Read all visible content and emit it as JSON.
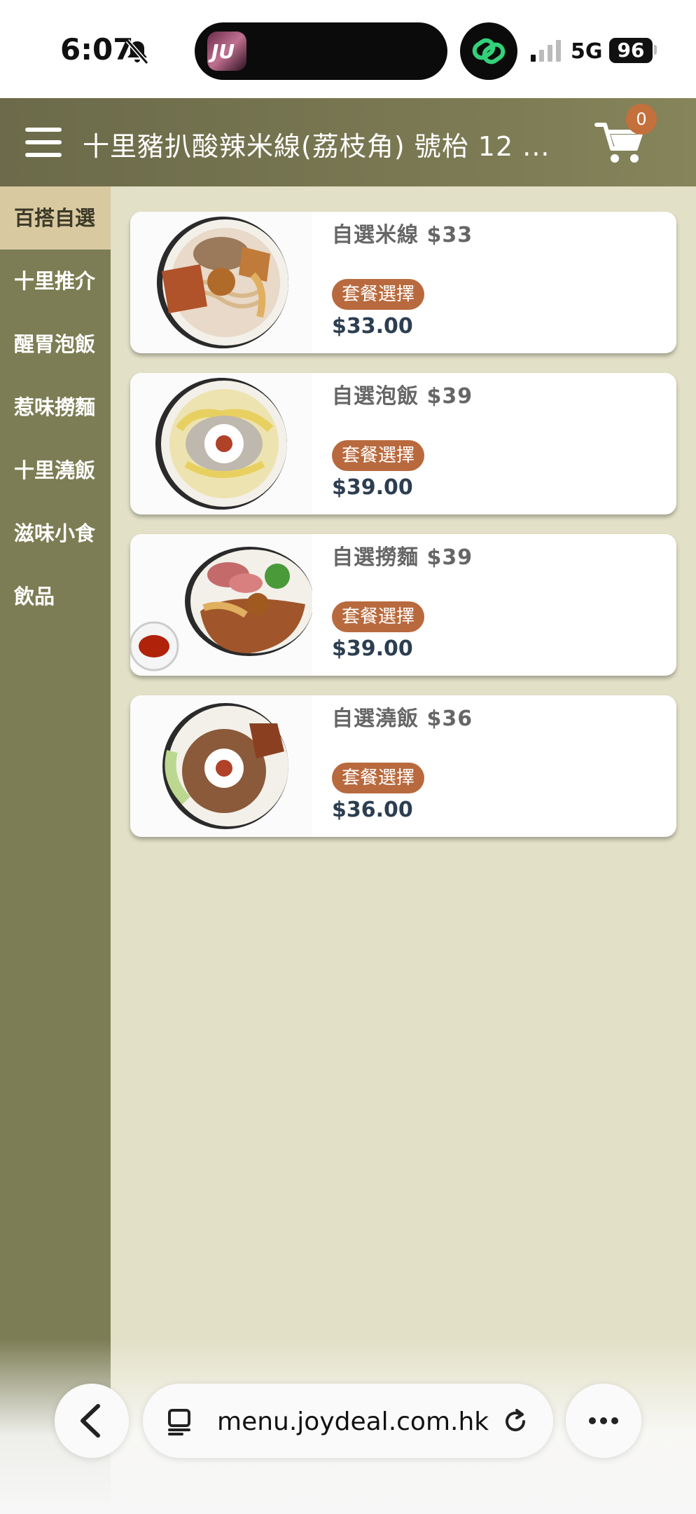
{
  "status_bar": {
    "time": "6:07",
    "network": "5G",
    "battery": "96",
    "island_app_label": "JU"
  },
  "header": {
    "store_title": "十里豬扒酸辣米線(荔枝角) 號枱 12 ...",
    "cart_count": "0"
  },
  "categories": [
    {
      "label": "百搭自選",
      "active": true
    },
    {
      "label": "十里推介",
      "active": false
    },
    {
      "label": "醒胃泡飯",
      "active": false
    },
    {
      "label": "惹味撈麵",
      "active": false
    },
    {
      "label": "十里澆飯",
      "active": false
    },
    {
      "label": "滋味小食",
      "active": false
    },
    {
      "label": "飲品",
      "active": false
    }
  ],
  "items": [
    {
      "name": "自選米線 $33",
      "button": "套餐選擇",
      "price": "$33.00",
      "image": "rice-noodle-bowl"
    },
    {
      "name": "自選泡飯 $39",
      "button": "套餐選擇",
      "price": "$39.00",
      "image": "soup-rice-bowl"
    },
    {
      "name": "自選撈麵 $39",
      "button": "套餐選擇",
      "price": "$39.00",
      "image": "tossed-noodle-bowl"
    },
    {
      "name": "自選澆飯 $36",
      "button": "套餐選擇",
      "price": "$36.00",
      "image": "topped-rice-bowl"
    }
  ],
  "browser": {
    "url": "menu.joydeal.com.hk"
  },
  "colors": {
    "header": "#7c7b54",
    "sidebar": "#7c7d54",
    "active_category": "#d9c9a1",
    "content_bg": "#e2e0c6",
    "set_button": "#b86a3e",
    "cart_badge": "#c4703c"
  }
}
